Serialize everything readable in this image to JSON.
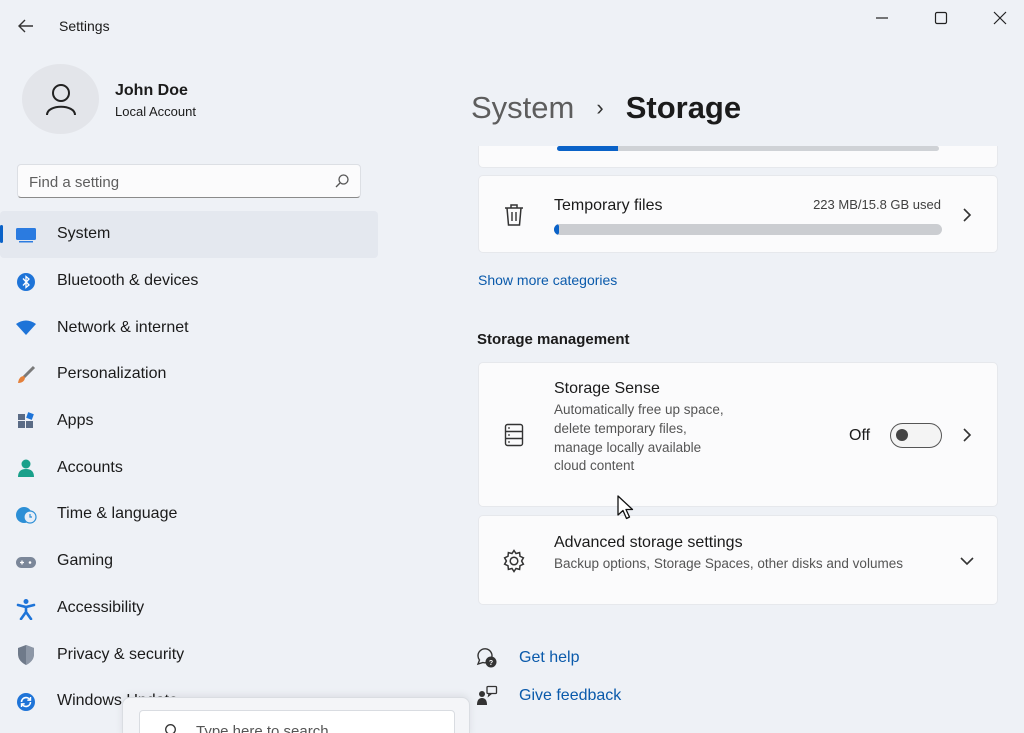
{
  "window": {
    "title": "Settings",
    "icons": {
      "back": "arrow-left-icon",
      "minimize": "minimize-icon",
      "maximize": "maximize-icon",
      "close": "close-icon"
    }
  },
  "profile": {
    "name": "John Doe",
    "account_type": "Local Account",
    "icon": "user-avatar-icon"
  },
  "search": {
    "placeholder": "Find a setting",
    "icon": "search-icon"
  },
  "nav": {
    "items": [
      {
        "label": "System",
        "icon": "system-display-icon",
        "active": true
      },
      {
        "label": "Bluetooth & devices",
        "icon": "bluetooth-icon"
      },
      {
        "label": "Network & internet",
        "icon": "wifi-icon"
      },
      {
        "label": "Personalization",
        "icon": "brush-icon"
      },
      {
        "label": "Apps",
        "icon": "apps-icon"
      },
      {
        "label": "Accounts",
        "icon": "accounts-icon"
      },
      {
        "label": "Time & language",
        "icon": "clock-globe-icon"
      },
      {
        "label": "Gaming",
        "icon": "gamepad-icon"
      },
      {
        "label": "Accessibility",
        "icon": "accessibility-icon"
      },
      {
        "label": "Privacy & security",
        "icon": "shield-icon"
      },
      {
        "label": "Windows Update",
        "icon": "windows-update-icon"
      }
    ]
  },
  "breadcrumb": {
    "parent": "System",
    "separator": "›",
    "current": "Storage"
  },
  "storage": {
    "top_strip_fill": 0.16,
    "temp_files": {
      "title": "Temporary files",
      "usage": "223 MB/15.8 GB used",
      "fill": 0.014,
      "icon": "trash-icon"
    },
    "show_more": "Show more categories"
  },
  "management": {
    "title": "Storage management",
    "storage_sense": {
      "title": "Storage Sense",
      "description": "Automatically free up space, delete temporary files, manage locally available cloud content",
      "toggle_label": "Off",
      "toggle_on": false,
      "icon": "storage-drive-icon"
    },
    "advanced": {
      "title": "Advanced storage settings",
      "description": "Backup options, Storage Spaces, other disks and volumes",
      "icon": "gear-icon"
    }
  },
  "help": {
    "get_help": "Get help",
    "give_feedback": "Give feedback",
    "get_help_icon": "help-chat-icon",
    "feedback_icon": "feedback-person-icon"
  },
  "taskbar_search": {
    "placeholder": "Type here to search",
    "icon": "search-icon"
  },
  "colors": {
    "accent": "#0a62c8",
    "link": "#0a5aab",
    "background": "#eef1f6",
    "card": "#fbfbfc"
  }
}
